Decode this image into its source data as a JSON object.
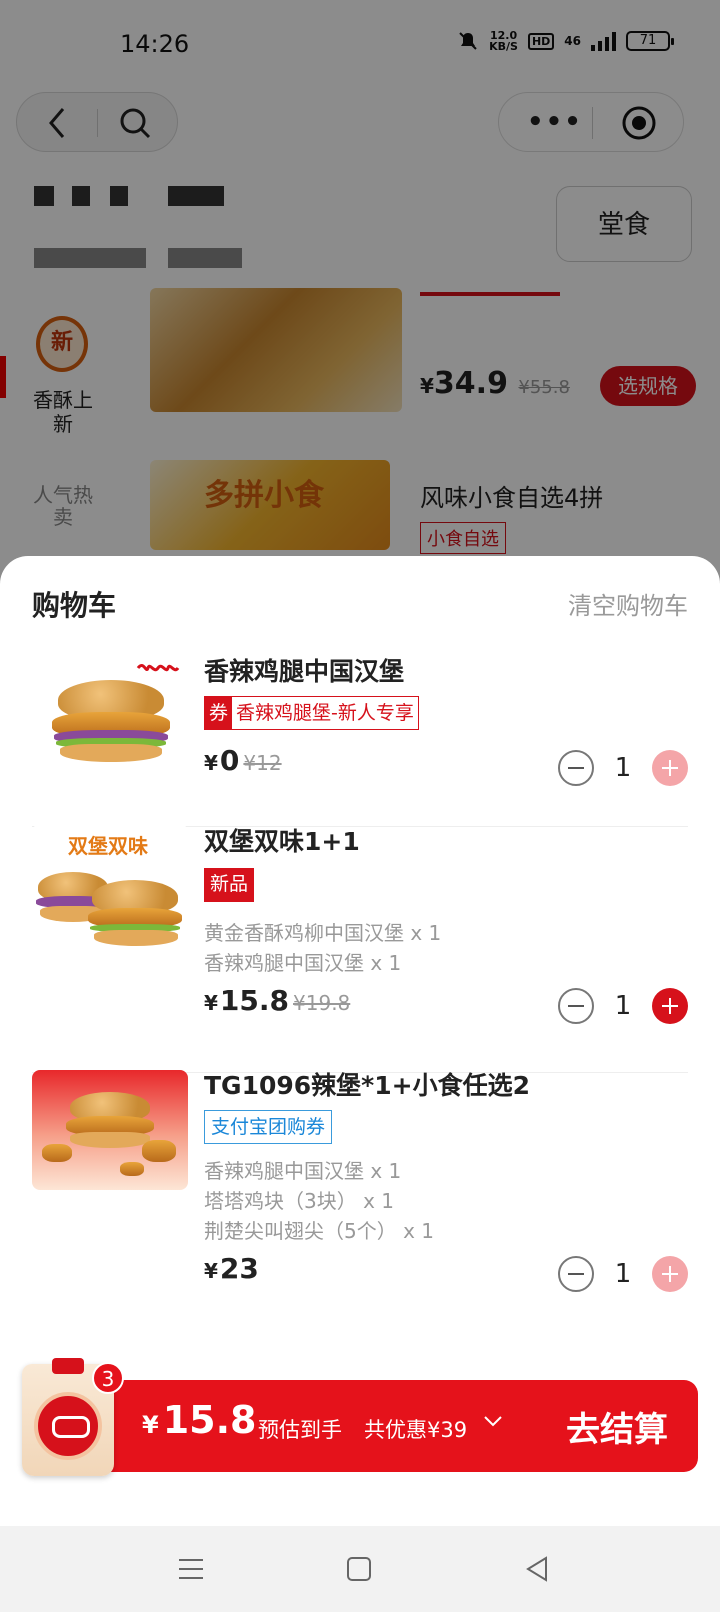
{
  "status_bar": {
    "time": "14:26",
    "net_speed_value": "12.0",
    "net_speed_unit": "KB/S",
    "hd": "HD",
    "network": "46",
    "battery": "71"
  },
  "background": {
    "dine_in_label": "堂食",
    "category_new": "香酥上新",
    "category_new_icon_text": "新",
    "category_hot": "人气热卖",
    "product1_price": "34.9",
    "product1_old_price": "¥55.8",
    "product1_button": "选规格",
    "product2_image_text": "多拼小食",
    "product2_title": "风味小食自选4拼",
    "product2_tag": "小食自选",
    "currency": "¥"
  },
  "cart": {
    "title": "购物车",
    "clear_label": "清空购物车",
    "items": [
      {
        "name": "香辣鸡腿中国汉堡",
        "tag_coupon_mark": "券",
        "tag_text": "香辣鸡腿堡-新人专享",
        "price": "0",
        "old_price": "¥12",
        "qty": "1"
      },
      {
        "name": "双堡双味1+1",
        "thumb_text": "双堡双味",
        "tag_text": "新品",
        "sub_lines": [
          "黄金香酥鸡柳中国汉堡 x 1",
          "香辣鸡腿中国汉堡 x 1"
        ],
        "price": "15.8",
        "old_price": "¥19.8",
        "qty": "1"
      },
      {
        "name": "TG1096辣堡*1+小食任选2",
        "tag_text": "支付宝团购券",
        "sub_lines": [
          "香辣鸡腿中国汉堡 x 1",
          "塔塔鸡块（3块） x 1",
          "荆楚尖叫翅尖（5个） x 1"
        ],
        "price": "23",
        "qty": "1"
      }
    ],
    "currency": "¥"
  },
  "checkout": {
    "badge_count": "3",
    "currency": "¥",
    "total": "15.8",
    "estimate_label": "预估到手",
    "saving_label": "共优惠¥39",
    "button_label": "去结算"
  },
  "colors": {
    "brand_red": "#e5121b",
    "coupon_blue": "#1a87d8"
  }
}
